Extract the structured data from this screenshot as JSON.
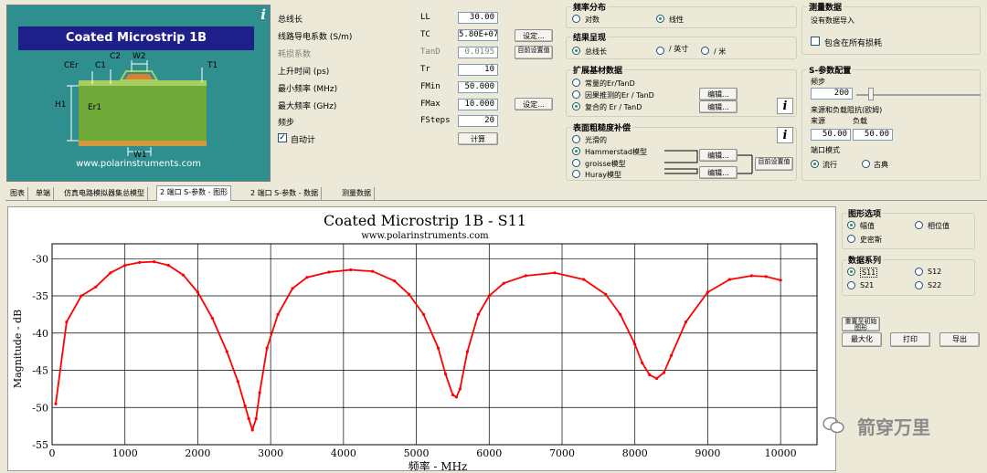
{
  "diagram": {
    "title": "Coated Microstrip 1B",
    "url": "www.polarinstruments.com",
    "labels": {
      "cer": "CEr",
      "c1": "C1",
      "c2": "C2",
      "w2": "W2",
      "t1": "T1",
      "h1": "H1",
      "er1": "Er1",
      "w1": "W1"
    },
    "info_icon": "i"
  },
  "params": [
    {
      "label": "总线长",
      "symbol": "LL",
      "value": "30.00",
      "disabled": false,
      "button": ""
    },
    {
      "label": "线路导电系数 (S/m)",
      "symbol": "TC",
      "value": "5.80E+07",
      "disabled": false,
      "button": "设定..."
    },
    {
      "label": "耗损系数",
      "symbol": "TanD",
      "value": "0.0195",
      "disabled": true,
      "button": "目前设置值"
    },
    {
      "label": "上升时间 (ps)",
      "symbol": "Tr",
      "value": "10",
      "disabled": false,
      "button": ""
    },
    {
      "label": "最小频率 (MHz)",
      "symbol": "FMin",
      "value": "50.000",
      "disabled": false,
      "button": ""
    },
    {
      "label": "最大频率 (GHz)",
      "symbol": "FMax",
      "value": "10.000",
      "disabled": false,
      "button": "设定..."
    },
    {
      "label": "频步",
      "symbol": "FSteps",
      "value": "20",
      "disabled": false,
      "button": ""
    }
  ],
  "auto_calc": {
    "label": "自动计",
    "checked": true
  },
  "calc_button": "计算",
  "freq_dist": {
    "title": "频率分布",
    "options": [
      "对数",
      "线性"
    ],
    "selected": 1
  },
  "result_display": {
    "title": "结果呈现",
    "options": [
      "总线长",
      "/ 英寸",
      "/ 米"
    ],
    "selected": 0
  },
  "ext_substrate": {
    "title": "扩展基材数据",
    "options": [
      "常量的Er/TanD",
      "因果推测的Er / TanD",
      "复合的 Er / TanD"
    ],
    "selected": 2,
    "edit_label": "编辑..."
  },
  "roughness": {
    "title": "表面粗糙度补偿",
    "options": [
      "光滑的",
      "Hammerstad模型",
      "groisse模型",
      "Huray模型"
    ],
    "selected": 1,
    "edit_label": "编辑...",
    "current_label": "目前设置值"
  },
  "measure": {
    "title": "测量数据",
    "status": "没有数据导入",
    "include_loss": "包含在所有损耗"
  },
  "sparam": {
    "title": "S-参数配置",
    "freq_step_label": "频步",
    "freq_step_value": "200",
    "source_load_label": "来源和负载阻抗(欧姆)",
    "source_label": "来源",
    "load_label": "负载",
    "source_value": "50.00",
    "load_value": "50.00",
    "port_mode_label": "端口模式",
    "port_modes": [
      "流行",
      "古典"
    ],
    "port_mode_selected": 0
  },
  "tabs": [
    "图表",
    "单端",
    "仿真电路模拟器集总模型",
    "2 端口 S-参数 - 图形",
    "2 端口 S-参数 - 数据",
    "测量数据"
  ],
  "active_tab": 3,
  "graph_options": {
    "title": "图形选项",
    "options": [
      "幅值",
      "相位值",
      "史密斯"
    ],
    "selected": 0
  },
  "data_series": {
    "title": "数据系列",
    "options": [
      "S11",
      "S12",
      "S21",
      "S22"
    ],
    "selected": 0
  },
  "side_buttons": {
    "redraw": "重置至初始图形",
    "maximize": "最大化",
    "print": "打印",
    "export": "导出"
  },
  "watermark": "箭穿万里",
  "chart_data": {
    "type": "line",
    "title": "Coated Microstrip 1B - S11",
    "subtitle": "www.polarinstruments.com",
    "xlabel": "频率 - MHz",
    "ylabel": "Magnitude - dB",
    "xlim": [
      0,
      10500
    ],
    "ylim": [
      -55,
      -28
    ],
    "xticks": [
      0,
      1000,
      2000,
      3000,
      4000,
      5000,
      6000,
      7000,
      8000,
      9000,
      10000
    ],
    "yticks": [
      -30,
      -35,
      -40,
      -45,
      -50,
      -55
    ],
    "grid": true,
    "color": "#ff0000",
    "series": [
      {
        "x": [
          50,
          200,
          400,
          600,
          800,
          1000,
          1200,
          1400,
          1600,
          1800,
          2000,
          2200,
          2400,
          2550,
          2650,
          2700,
          2750,
          2800,
          2850,
          2950,
          3100,
          3300,
          3500,
          3800,
          4100,
          4400,
          4700,
          4900,
          5100,
          5300,
          5400,
          5500,
          5550,
          5600,
          5700,
          5850,
          6000,
          6200,
          6500,
          6900,
          7300,
          7600,
          7800,
          8000,
          8100,
          8200,
          8300,
          8400,
          8500,
          8700,
          9000,
          9300,
          9600,
          9800,
          10000
        ],
        "y": [
          -49.5,
          -38.5,
          -35.0,
          -33.8,
          -31.9,
          -30.9,
          -30.5,
          -30.4,
          -30.9,
          -32.2,
          -34.5,
          -38.0,
          -42.5,
          -46.5,
          -49.8,
          -51.5,
          -53.0,
          -51.5,
          -48.0,
          -42.0,
          -37.5,
          -34.0,
          -32.5,
          -31.8,
          -31.5,
          -31.7,
          -33.0,
          -34.8,
          -37.5,
          -42.0,
          -45.5,
          -48.3,
          -48.6,
          -47.5,
          -42.5,
          -37.5,
          -35.0,
          -33.3,
          -32.3,
          -31.9,
          -32.8,
          -34.8,
          -37.5,
          -41.5,
          -44.0,
          -45.6,
          -46.1,
          -45.3,
          -43.0,
          -38.5,
          -34.5,
          -32.8,
          -32.3,
          -32.4,
          -32.9
        ]
      }
    ]
  }
}
